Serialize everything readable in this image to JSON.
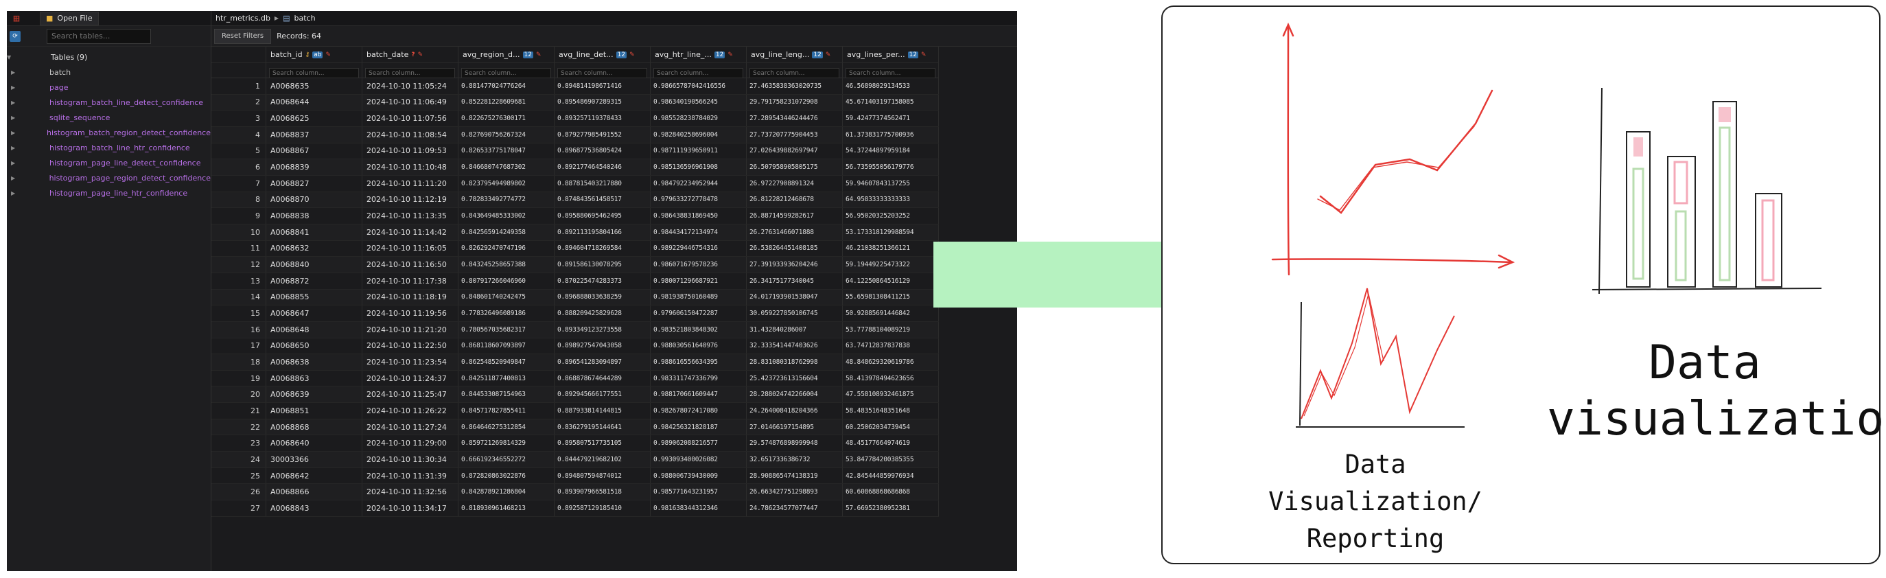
{
  "app": {
    "open_file_label": "Open File",
    "sidebar_search_placeholder": "Search tables...",
    "tables_header": "Tables (9)",
    "tables": [
      {
        "name": "batch",
        "kind": "system"
      },
      {
        "name": "page",
        "kind": "user"
      },
      {
        "name": "histogram_batch_line_detect_confidence",
        "kind": "user"
      },
      {
        "name": "sqlite_sequence",
        "kind": "user"
      },
      {
        "name": "histogram_batch_region_detect_confidence",
        "kind": "user"
      },
      {
        "name": "histogram_batch_line_htr_confidence",
        "kind": "user"
      },
      {
        "name": "histogram_page_line_detect_confidence",
        "kind": "user"
      },
      {
        "name": "histogram_page_region_detect_confidence",
        "kind": "user"
      },
      {
        "name": "histogram_page_line_htr_confidence",
        "kind": "user"
      }
    ],
    "breadcrumb": {
      "db": "htr_metrics.db",
      "table": "batch"
    },
    "reset_filters_label": "Reset Filters",
    "records_label": "Records: 64",
    "columns": [
      "batch_id",
      "batch_date",
      "avg_region_d...",
      "avg_line_det...",
      "avg_htr_line_...",
      "avg_line_leng...",
      "avg_lines_per..."
    ],
    "column_search_placeholder": "Search column...",
    "rows": [
      [
        "1",
        "A0068635",
        "2024-10-10 11:05:24",
        "0.881477024776264",
        "0.894814198671416",
        "0.98665787042416556",
        "27.4635838363020735",
        "46.56898029134533"
      ],
      [
        "2",
        "A0068644",
        "2024-10-10 11:06:49",
        "0.852281228609681",
        "0.895486907289315",
        "0.986340190566245",
        "29.791758231072908",
        "45.671403197158085"
      ],
      [
        "3",
        "A0068625",
        "2024-10-10 11:07:56",
        "0.822675276300171",
        "0.893257119378433",
        "0.985528238784029",
        "27.289543446244476",
        "59.42477374562471"
      ],
      [
        "4",
        "A0068837",
        "2024-10-10 11:08:54",
        "0.827690756267324",
        "0.879277985491552",
        "0.982840258696004",
        "27.737207775904453",
        "61.373831775700936"
      ],
      [
        "5",
        "A0068867",
        "2024-10-10 11:09:53",
        "0.826533775178047",
        "0.896877536805424",
        "0.987111939650911",
        "27.026439882697947",
        "54.37244897959184"
      ],
      [
        "6",
        "A0068839",
        "2024-10-10 11:10:48",
        "0.846680747687302",
        "0.892177464540246",
        "0.985136596961908",
        "26.507958905805175",
        "56.735955056179776"
      ],
      [
        "7",
        "A0068827",
        "2024-10-10 11:11:20",
        "0.823795494989802",
        "0.887815403217880",
        "0.984792234952944",
        "26.97227908891324",
        "59.94607843137255"
      ],
      [
        "8",
        "A0068870",
        "2024-10-10 11:12:19",
        "0.782833492774772",
        "0.874843561458517",
        "0.979633272778478",
        "26.81228212468678",
        "64.95833333333333"
      ],
      [
        "9",
        "A0068838",
        "2024-10-10 11:13:35",
        "0.843649485333002",
        "0.895880695462495",
        "0.986438831869450",
        "26.88714599282617",
        "56.95020325203252"
      ],
      [
        "10",
        "A0068841",
        "2024-10-10 11:14:42",
        "0.842565914249358",
        "0.892113195804166",
        "0.984434172134974",
        "26.27631466071888",
        "53.173318129988594"
      ],
      [
        "11",
        "A0068632",
        "2024-10-10 11:16:05",
        "0.826292470747196",
        "0.894604718269584",
        "0.989229446754316",
        "26.538264451408185",
        "46.21038251366121"
      ],
      [
        "12",
        "A0068840",
        "2024-10-10 11:16:50",
        "0.843245258657388",
        "0.891586130078295",
        "0.986071679578236",
        "27.391933936204246",
        "59.19449225473322"
      ],
      [
        "13",
        "A0068872",
        "2024-10-10 11:17:38",
        "0.807917266046960",
        "0.870225474283373",
        "0.980071296687921",
        "26.34175177340045",
        "64.12250864516129"
      ],
      [
        "14",
        "A0068855",
        "2024-10-10 11:18:19",
        "0.848601740242475",
        "0.896888033638259",
        "0.981938750160489",
        "24.017193901538047",
        "55.65981308411215"
      ],
      [
        "15",
        "A0068647",
        "2024-10-10 11:19:56",
        "0.778326496089186",
        "0.888209425829628",
        "0.979606150472287",
        "30.059227850106745",
        "50.92885691446842"
      ],
      [
        "16",
        "A0068648",
        "2024-10-10 11:21:20",
        "0.780567035682317",
        "0.893349123273558",
        "0.983521803848302",
        "31.432840286007",
        "53.77788104089219"
      ],
      [
        "17",
        "A0068650",
        "2024-10-10 11:22:50",
        "0.868118607093897",
        "0.898927547043058",
        "0.988030561640976",
        "32.333541447403626",
        "63.74712837837838"
      ],
      [
        "18",
        "A0068638",
        "2024-10-10 11:23:54",
        "0.862548520949847",
        "0.896541283094897",
        "0.988616556634395",
        "28.831080318762998",
        "48.848629320619786"
      ],
      [
        "19",
        "A0068863",
        "2024-10-10 11:24:37",
        "0.842511877400813",
        "0.868878674644289",
        "0.983311747336799",
        "25.423723613156604",
        "58.413978494623656"
      ],
      [
        "20",
        "A0068639",
        "2024-10-10 11:25:47",
        "0.844533087154963",
        "0.892945666177551",
        "0.988170661609447",
        "28.288024742266004",
        "47.558108932461875"
      ],
      [
        "21",
        "A0068851",
        "2024-10-10 11:26:22",
        "0.845717827855411",
        "0.887933814144815",
        "0.982678072417080",
        "24.264008418204366",
        "58.48351648351648"
      ],
      [
        "22",
        "A0068868",
        "2024-10-10 11:27:24",
        "0.864646275312854",
        "0.836279195144641",
        "0.984256321828187",
        "27.01466197154895",
        "60.25062034739454"
      ],
      [
        "23",
        "A0068640",
        "2024-10-10 11:29:00",
        "0.859721269814329",
        "0.895807517735105",
        "0.989062088216577",
        "29.574876898999948",
        "48.45177664974619"
      ],
      [
        "24",
        "30003366",
        "2024-10-10 11:30:34",
        "0.666192346552272",
        "0.844479219682102",
        "0.993093400026082",
        "32.6517336386732",
        "53.847784200385355"
      ],
      [
        "25",
        "A0068642",
        "2024-10-10 11:31:39",
        "0.872820863022876",
        "0.894807594874012",
        "0.988006739430009",
        "28.908865474138319",
        "42.845444859976934"
      ],
      [
        "26",
        "A0068866",
        "2024-10-10 11:32:56",
        "0.842878921286804",
        "0.893907966581518",
        "0.985771643231957",
        "26.663427751298893",
        "60.60868868686868"
      ],
      [
        "27",
        "A0068843",
        "2024-10-10 11:34:17",
        "0.818930961468213",
        "0.892587129185410",
        "0.981638344312346",
        "24.786234577077447",
        "57.66952380952381"
      ]
    ]
  },
  "whiteboard": {
    "left_caption": "Data Visualization/\nReporting",
    "right_caption_line1": "Data",
    "right_caption_line2": "visualization"
  },
  "colors": {
    "arrow": "#b6f2c0",
    "sketch_red": "#e53935",
    "bar_pink": "#f4a9b8",
    "bar_green": "#b9ddb0",
    "purple_table": "#b76fe6"
  }
}
